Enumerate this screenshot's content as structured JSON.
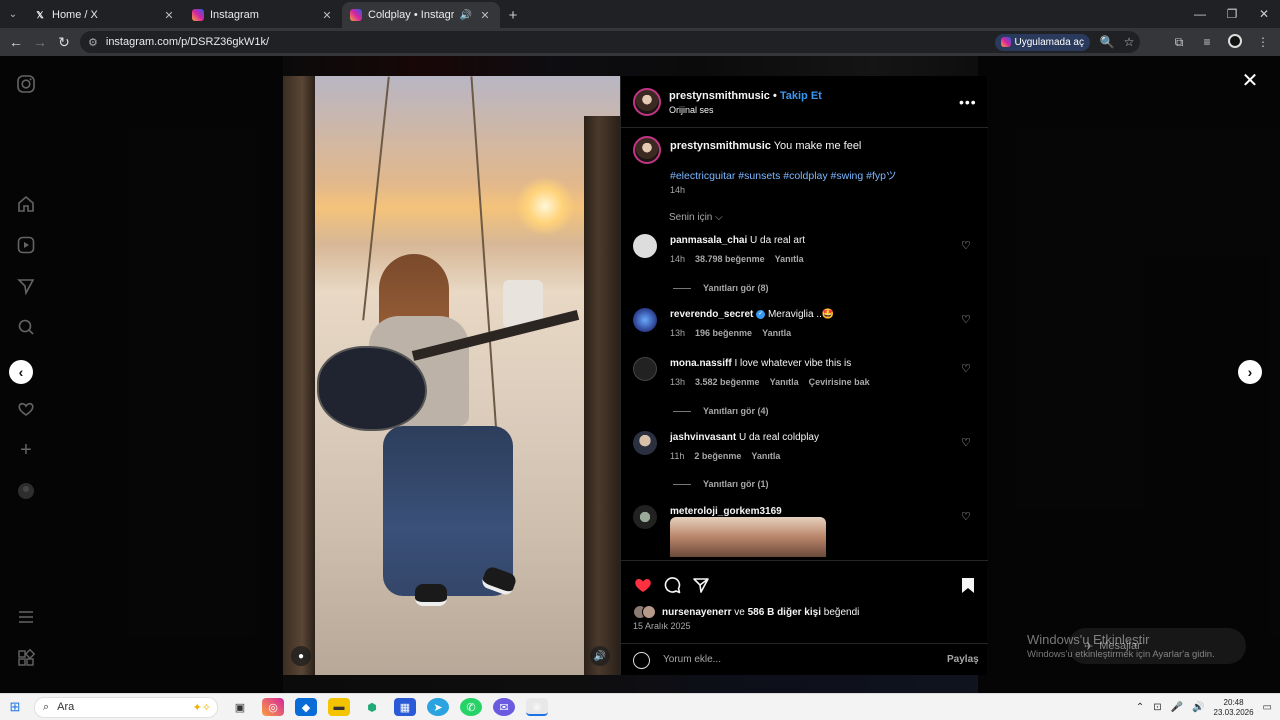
{
  "browser": {
    "tabs": [
      {
        "title": "Home / X",
        "favicon": "x-icon"
      },
      {
        "title": "Instagram",
        "favicon": "instagram-icon"
      },
      {
        "title": "Coldplay • Instagram",
        "favicon": "instagram-icon",
        "active": true
      }
    ],
    "url": "instagram.com/p/DSRZ36gkW1k/",
    "open_in_app": "Uygulamada aç"
  },
  "post": {
    "author": "prestynsmithmusic",
    "separator": "•",
    "follow": "Takip Et",
    "audio": "Orijinal ses",
    "caption_user": "prestynsmithmusic",
    "caption": "You make me feel",
    "hashtags": [
      "#electricguitar",
      "#sunsets",
      "#coldplay",
      "#swing",
      "#fyp"
    ],
    "hashtag_suffix": "ツ",
    "caption_time": "14h",
    "filter": "Senin için",
    "comments": [
      {
        "user": "panmasala_chai",
        "text": "U da real art",
        "time": "14h",
        "likes": "38.798 beğenme",
        "reply": "Yanıtla",
        "replies": "Yanıtları gör (8)"
      },
      {
        "user": "reverendo_secret",
        "verified": true,
        "text": "Meraviglia ..🤩",
        "time": "13h",
        "likes": "196 beğenme",
        "reply": "Yanıtla"
      },
      {
        "user": "mona.nassiff",
        "text": "I love whatever vibe this is",
        "time": "13h",
        "likes": "3.582 beğenme",
        "reply": "Yanıtla",
        "translate": "Çevirisine bak",
        "replies": "Yanıtları gör (4)"
      },
      {
        "user": "jashvinvasant",
        "text": "U da real coldplay",
        "time": "11h",
        "likes": "2 beğenme",
        "reply": "Yanıtla",
        "replies": "Yanıtları gör (1)"
      },
      {
        "user": "meteroloji_gorkem3169",
        "text": ""
      }
    ],
    "liked_by_user": "nursenayenerr",
    "liked_by_mid": "ve",
    "liked_by_others": "586 B diğer kişi",
    "liked_by_suffix": "beğendi",
    "date": "15 Aralık 2025",
    "comment_placeholder": "Yorum ekle...",
    "share": "Paylaş",
    "like_color": "#ff3040",
    "link_color": "#3897f0"
  },
  "watermark": {
    "title": "Windows'u Etkinleştir",
    "subtitle": "Windows'u etkinleştirmek için Ayarlar'a gidin.",
    "messages": "Mesajlar"
  },
  "taskbar": {
    "search": "Ara",
    "time": "20:48",
    "date": "23.03.2026"
  }
}
